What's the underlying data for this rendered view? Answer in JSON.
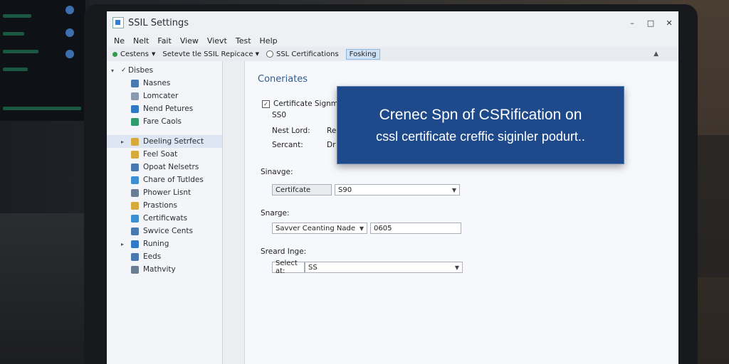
{
  "window": {
    "title": "SSIL Settings",
    "controls": {
      "minimize": "–",
      "maximize": "□",
      "close": "✕"
    }
  },
  "menu": [
    "Ne",
    "Nelt",
    "Fait",
    "View",
    "Vievt",
    "Test",
    "Help"
  ],
  "toolbar": {
    "item1": "Cestens",
    "item2": "Setevte tle SSIL Repicace",
    "item3": "SSL Certifications",
    "item4": "Fosking"
  },
  "sidebar": {
    "root": "Disbes",
    "group1": [
      {
        "label": "Nasnes",
        "icon": "server-icon",
        "color": "#4a78b0"
      },
      {
        "label": "Lomcater",
        "icon": "document-icon",
        "color": "#8a9bb0"
      },
      {
        "label": "Nend Petures",
        "icon": "globe-icon",
        "color": "#2f7ac4"
      },
      {
        "label": "Fare Caols",
        "icon": "shield-icon",
        "color": "#2f9a6a"
      }
    ],
    "selected": "Deeling Setrfect",
    "group2": [
      {
        "label": "Feel Soat",
        "icon": "folder-icon",
        "color": "#d6a93a"
      },
      {
        "label": "Opoat Nelsetrs",
        "icon": "network-icon",
        "color": "#4a78b0"
      },
      {
        "label": "Chare of Tutldes",
        "icon": "table-icon",
        "color": "#3c8fd0"
      },
      {
        "label": "Phower Lisnt",
        "icon": "user-icon",
        "color": "#6b7d95"
      },
      {
        "label": "Prastions",
        "icon": "lock-icon",
        "color": "#d6a93a"
      },
      {
        "label": "Certificwats",
        "icon": "certificate-icon",
        "color": "#3c8fd0"
      },
      {
        "label": "Swvice Cents",
        "icon": "list-icon",
        "color": "#4a78b0"
      },
      {
        "label": "Runing",
        "icon": "globe-icon",
        "color": "#2f7ac4"
      },
      {
        "label": "Eeds",
        "icon": "database-icon",
        "color": "#4a78b0"
      },
      {
        "label": "Mathvity",
        "icon": "list-icon",
        "color": "#6b7d95"
      }
    ]
  },
  "content": {
    "title": "Coneriates",
    "checkbox_label": "Certificate Signmest",
    "checkbox_sub": "SS0",
    "next_lord_label": "Nest Lord:",
    "next_lord_value": "Re",
    "sercant_label": "Sercant:",
    "sercant_value": "Dr",
    "group1_label": "Sinavge:",
    "group1_field1": "Certifcate",
    "group1_field2": "S90",
    "group2_label": "Snarge:",
    "group2_field1": "Savver Ceanting Nade",
    "group2_field2": "0605",
    "group3_label": "Sreard Inge:",
    "group3_field1": "Select at:",
    "group3_field2": "SS"
  },
  "banner": {
    "line1": "Crenec Spn  of CSRification on",
    "line2": "cssl certificate creffic siginler podurt.."
  }
}
